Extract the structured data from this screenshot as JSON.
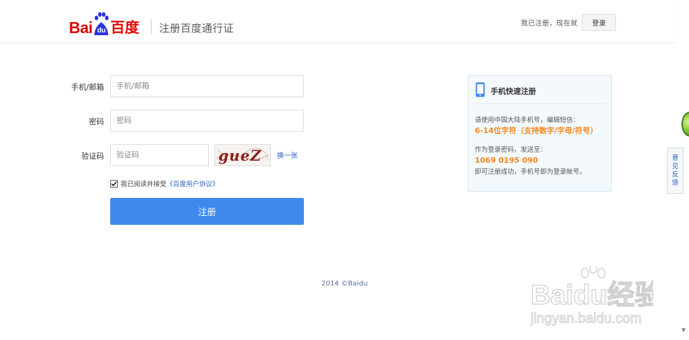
{
  "header": {
    "logo": {
      "bai": "Bai",
      "du": "du",
      "cn": "百度"
    },
    "page_title": "注册百度通行证",
    "already_text": "我已注册，现在就",
    "login_label": "登录"
  },
  "form": {
    "phone_label": "手机/邮箱",
    "phone_placeholder": "手机/邮箱",
    "password_label": "密码",
    "password_placeholder": "密码",
    "captcha_label": "验证码",
    "captcha_placeholder": "验证码",
    "captcha_text": "gueZ",
    "refresh_label": "换一张",
    "agree_checked": true,
    "agree_text": "我已阅读并接受",
    "agree_link": "《百度用户协议》",
    "register_label": "注册"
  },
  "sms_box": {
    "title": "手机快速注册",
    "line1": "请使用中国大陆手机号，编辑短信：",
    "line2": "6-14位字符（支持数字/字母/符号）",
    "line3": "作为登录密码，发送至：",
    "line4": "1069 0195 090",
    "line5": "即可注册成功，手机号即为登录帐号。"
  },
  "footer": {
    "copyright": "2014 ©Baidu"
  },
  "feedback": {
    "chars": [
      "意",
      "见",
      "反",
      "馈"
    ]
  },
  "watermark": {
    "brand": "Baidu经验",
    "url": "jingyan.baidu.com"
  },
  "colors": {
    "brand_red": "#e10602",
    "brand_blue": "#2932e1",
    "button_blue": "#3f89ec",
    "link_blue": "#2a62c4",
    "orange": "#f5881f"
  }
}
